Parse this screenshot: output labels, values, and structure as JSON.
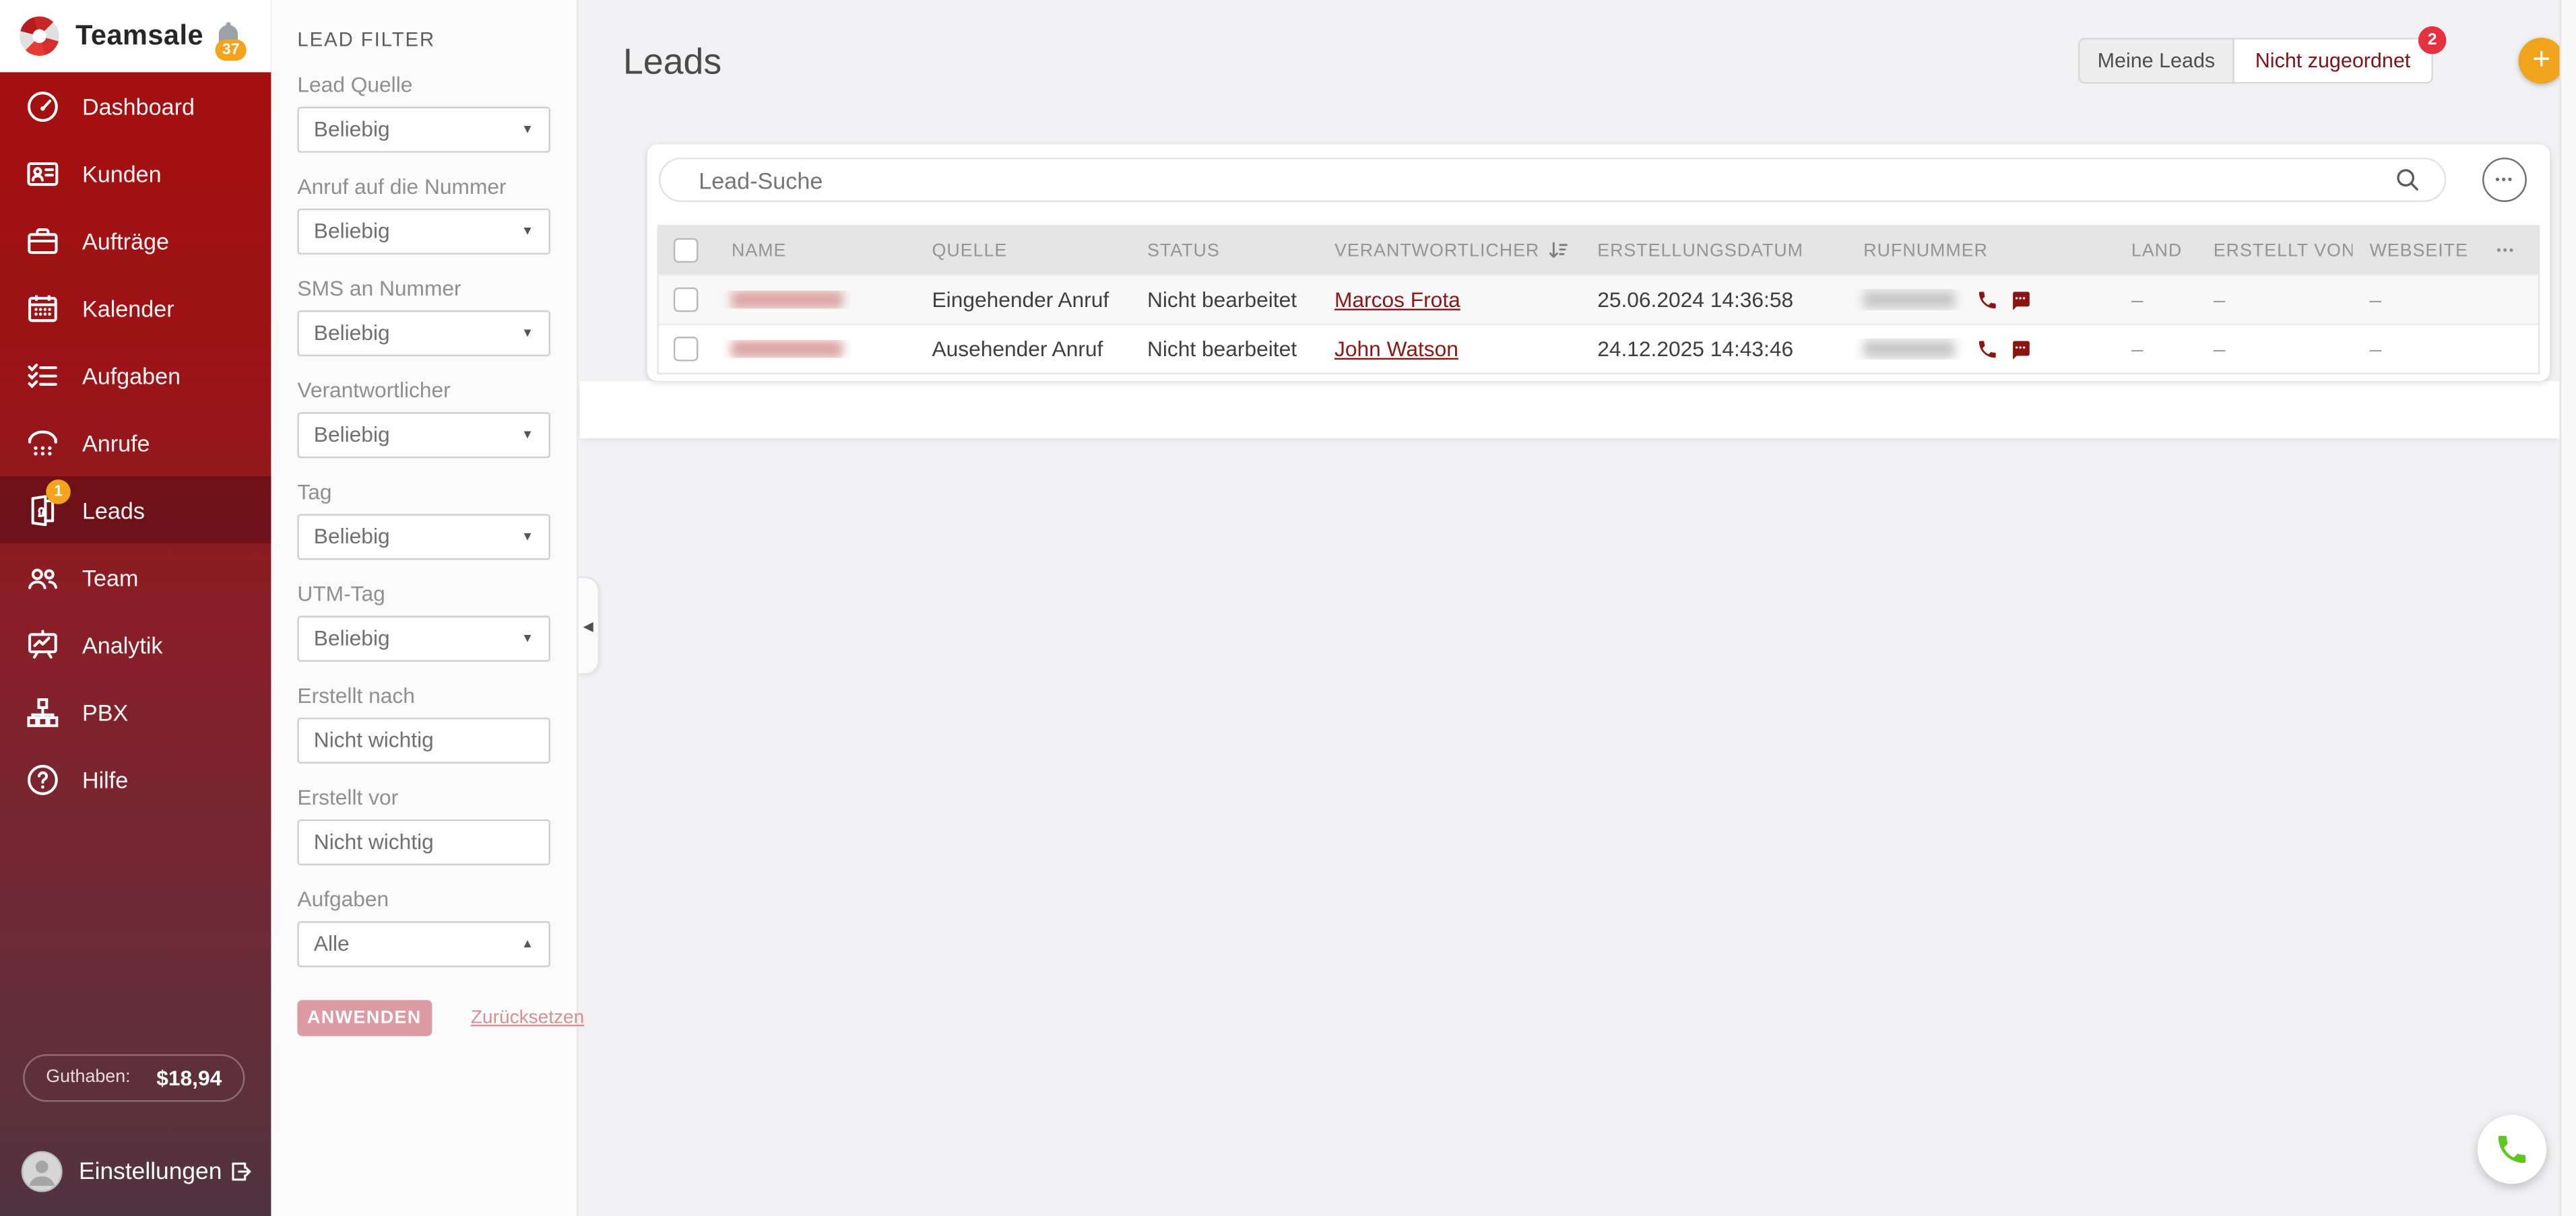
{
  "app": {
    "name": "Teamsale",
    "notifications_count": "37"
  },
  "colors": {
    "sidebar_red_top": "#a80e0e",
    "sidebar_bottom": "#503440",
    "accent_amber": "#f2a41c",
    "badge_red": "#e53140",
    "link_red": "#8c1717",
    "fab_green": "#5ec61e",
    "apply_pink": "#dc9ba3"
  },
  "icons": {
    "ellipsis": "•••",
    "caret_down": "▼",
    "caret_up": "▲",
    "collapse": "◀",
    "plus": "+"
  },
  "sidebar": {
    "items": [
      {
        "label": "Dashboard"
      },
      {
        "label": "Kunden"
      },
      {
        "label": "Aufträge"
      },
      {
        "label": "Kalender"
      },
      {
        "label": "Aufgaben"
      },
      {
        "label": "Anrufe"
      },
      {
        "label": "Leads",
        "badge": "1",
        "active": true
      },
      {
        "label": "Team"
      },
      {
        "label": "Analytik"
      },
      {
        "label": "PBX"
      },
      {
        "label": "Hilfe"
      }
    ],
    "balance_label": "Guthaben:",
    "balance_value": "$18,94",
    "settings_label": "Einstellungen"
  },
  "filters": {
    "title": "LEAD FILTER",
    "fields": [
      {
        "label": "Lead Quelle",
        "value": "Beliebig"
      },
      {
        "label": "Anruf auf die Nummer",
        "value": "Beliebig"
      },
      {
        "label": "SMS an Nummer",
        "value": "Beliebig"
      },
      {
        "label": "Verantwortlicher",
        "value": "Beliebig"
      },
      {
        "label": "Tag",
        "value": "Beliebig"
      },
      {
        "label": "UTM-Tag",
        "value": "Beliebig"
      },
      {
        "label": "Erstellt nach",
        "value": "Nicht wichtig"
      },
      {
        "label": "Erstellt vor",
        "value": "Nicht wichtig"
      },
      {
        "label": "Aufgaben",
        "value": "Alle"
      }
    ],
    "apply_label": "ANWENDEN",
    "reset_label": "Zurücksetzen"
  },
  "header": {
    "title": "Leads",
    "tab_my": "Meine Leads",
    "tab_unassigned": "Nicht zugeordnet",
    "unassigned_badge": "2"
  },
  "search": {
    "placeholder": "Lead-Suche"
  },
  "table": {
    "columns": [
      "NAME",
      "QUELLE",
      "STATUS",
      "VERANTWORTLICHER",
      "ERSTELLUNGSDATUM",
      "RUFNUMMER",
      "LAND",
      "ERSTELLT VON",
      "WEBSEITE"
    ],
    "rows": [
      {
        "name_redacted": true,
        "quelle": "Eingehender Anruf",
        "status": "Nicht bearbeitet",
        "verantwortlicher": "Marcos Frota",
        "erstellungsdatum": "25.06.2024 14:36:58",
        "rufnummer_redacted": true,
        "land": "–",
        "erstellt_von": "–",
        "webseite": "–"
      },
      {
        "name_redacted": true,
        "quelle": "Ausehender Anruf",
        "status": "Nicht bearbeitet",
        "verantwortlicher": "John Watson",
        "erstellungsdatum": "24.12.2025 14:43:46",
        "rufnummer_redacted": true,
        "land": "–",
        "erstellt_von": "–",
        "webseite": "–"
      }
    ]
  }
}
